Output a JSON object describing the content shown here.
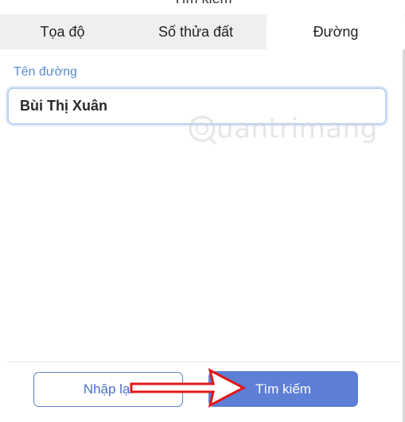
{
  "dialog": {
    "title": "Tìm kiếm"
  },
  "tabs": [
    {
      "label": "Tọa độ",
      "active": false
    },
    {
      "label": "Số thửa đất",
      "active": false
    },
    {
      "label": "Đường",
      "active": true
    }
  ],
  "form": {
    "street_label": "Tên đường",
    "street_value": "Bùi Thị Xuân"
  },
  "watermark": {
    "text": "uantrimang"
  },
  "buttons": {
    "reset_label": "Nhập lại",
    "search_label": "Tìm kiếm"
  },
  "colors": {
    "accent": "#5a8bd6",
    "primary_button": "#5d7fd6",
    "arrow": "#e01818"
  }
}
